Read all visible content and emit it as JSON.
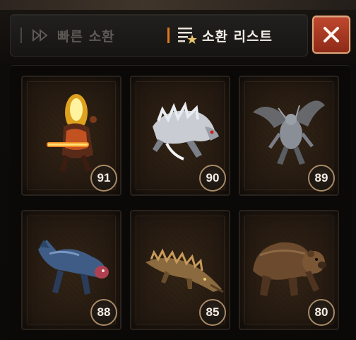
{
  "tabs": {
    "quick_summon": "빠른 소환",
    "summon_list": "소환 리스트"
  },
  "close_label": "✕",
  "accent_color": "#e0781c",
  "summons": [
    {
      "name": "flame-demon",
      "level": "91"
    },
    {
      "name": "white-wolf",
      "level": "90"
    },
    {
      "name": "winged-gargoyle",
      "level": "89"
    },
    {
      "name": "blue-wolf",
      "level": "88"
    },
    {
      "name": "spiked-crocodile",
      "level": "85"
    },
    {
      "name": "brown-bear",
      "level": "80"
    }
  ]
}
